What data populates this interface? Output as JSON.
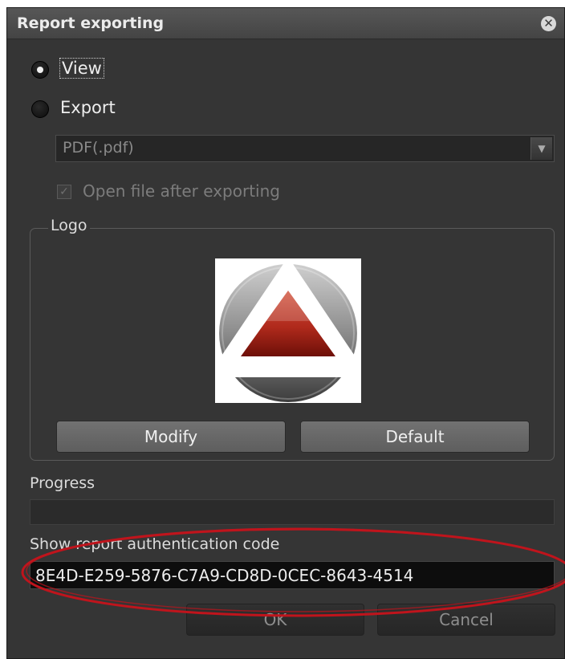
{
  "dialog": {
    "title": "Report exporting",
    "close_icon": "close-icon"
  },
  "mode": {
    "options": [
      {
        "label": "View",
        "selected": true
      },
      {
        "label": "Export",
        "selected": false
      }
    ]
  },
  "format": {
    "selected": "PDF(.pdf)",
    "arrow_icon": "chevron-down-icon"
  },
  "open_after_export": {
    "label": "Open file after exporting",
    "checked": true,
    "enabled": false
  },
  "logo": {
    "legend": "Logo",
    "modify_label": "Modify",
    "default_label": "Default"
  },
  "progress": {
    "label": "Progress",
    "value": 0
  },
  "auth_code": {
    "label": "Show report authentication code",
    "value": "8E4D-E259-5876-C7A9-CD8D-0CEC-8643-4514"
  },
  "footer": {
    "ok_label": "OK",
    "cancel_label": "Cancel"
  },
  "colors": {
    "dialog_bg": "#353535",
    "annotation": "#c0141c",
    "logo_red": "#b02a1c"
  }
}
